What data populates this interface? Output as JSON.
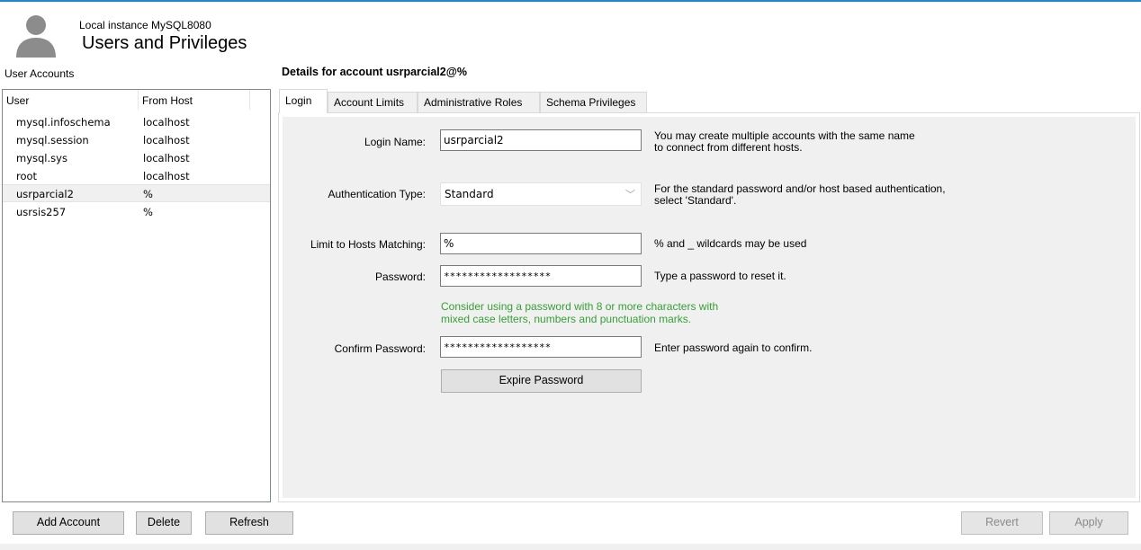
{
  "header": {
    "instance": "Local instance MySQL8080",
    "title": "Users and Privileges"
  },
  "accounts": {
    "section_label": "User Accounts",
    "columns": [
      "User",
      "From Host"
    ],
    "rows": [
      {
        "user": "mysql.infoschema",
        "host": "localhost"
      },
      {
        "user": "mysql.session",
        "host": "localhost"
      },
      {
        "user": "mysql.sys",
        "host": "localhost"
      },
      {
        "user": "root",
        "host": "localhost"
      },
      {
        "user": "usrparcial2",
        "host": "%"
      },
      {
        "user": "usrsis257",
        "host": "%"
      }
    ],
    "selected_index": 4
  },
  "details": {
    "title": "Details for account usrparcial2@%",
    "tabs": [
      "Login",
      "Account Limits",
      "Administrative Roles",
      "Schema Privileges"
    ],
    "active_tab": "Login",
    "login_name_label": "Login Name:",
    "login_name_value": "usrparcial2",
    "login_name_help": "You may create multiple accounts with the same name\nto connect from different hosts.",
    "auth_type_label": "Authentication Type:",
    "auth_type_value": "Standard",
    "auth_type_help": "For the standard password and/or host based authentication,\nselect 'Standard'.",
    "hosts_label": "Limit to Hosts Matching:",
    "hosts_value": "%",
    "hosts_help": "% and _ wildcards may be used",
    "password_label": "Password:",
    "password_value": "******************",
    "password_help": "Type a password to reset it.",
    "password_hint": "Consider using a password with 8 or more characters with\nmixed case letters, numbers and punctuation marks.",
    "confirm_label": "Confirm Password:",
    "confirm_value": "******************",
    "confirm_help": "Enter password again to confirm.",
    "expire_button": "Expire Password"
  },
  "footer": {
    "add_account": "Add Account",
    "delete": "Delete",
    "refresh": "Refresh",
    "revert": "Revert",
    "apply": "Apply"
  },
  "colors": {
    "accent_rule": "#1e88c9",
    "hint_green": "#35a035",
    "panel_bg": "#f0f0f0"
  },
  "icons": {
    "header_avatar": "user-silhouette-icon",
    "dropdown_arrow": "chevron-down-icon"
  }
}
